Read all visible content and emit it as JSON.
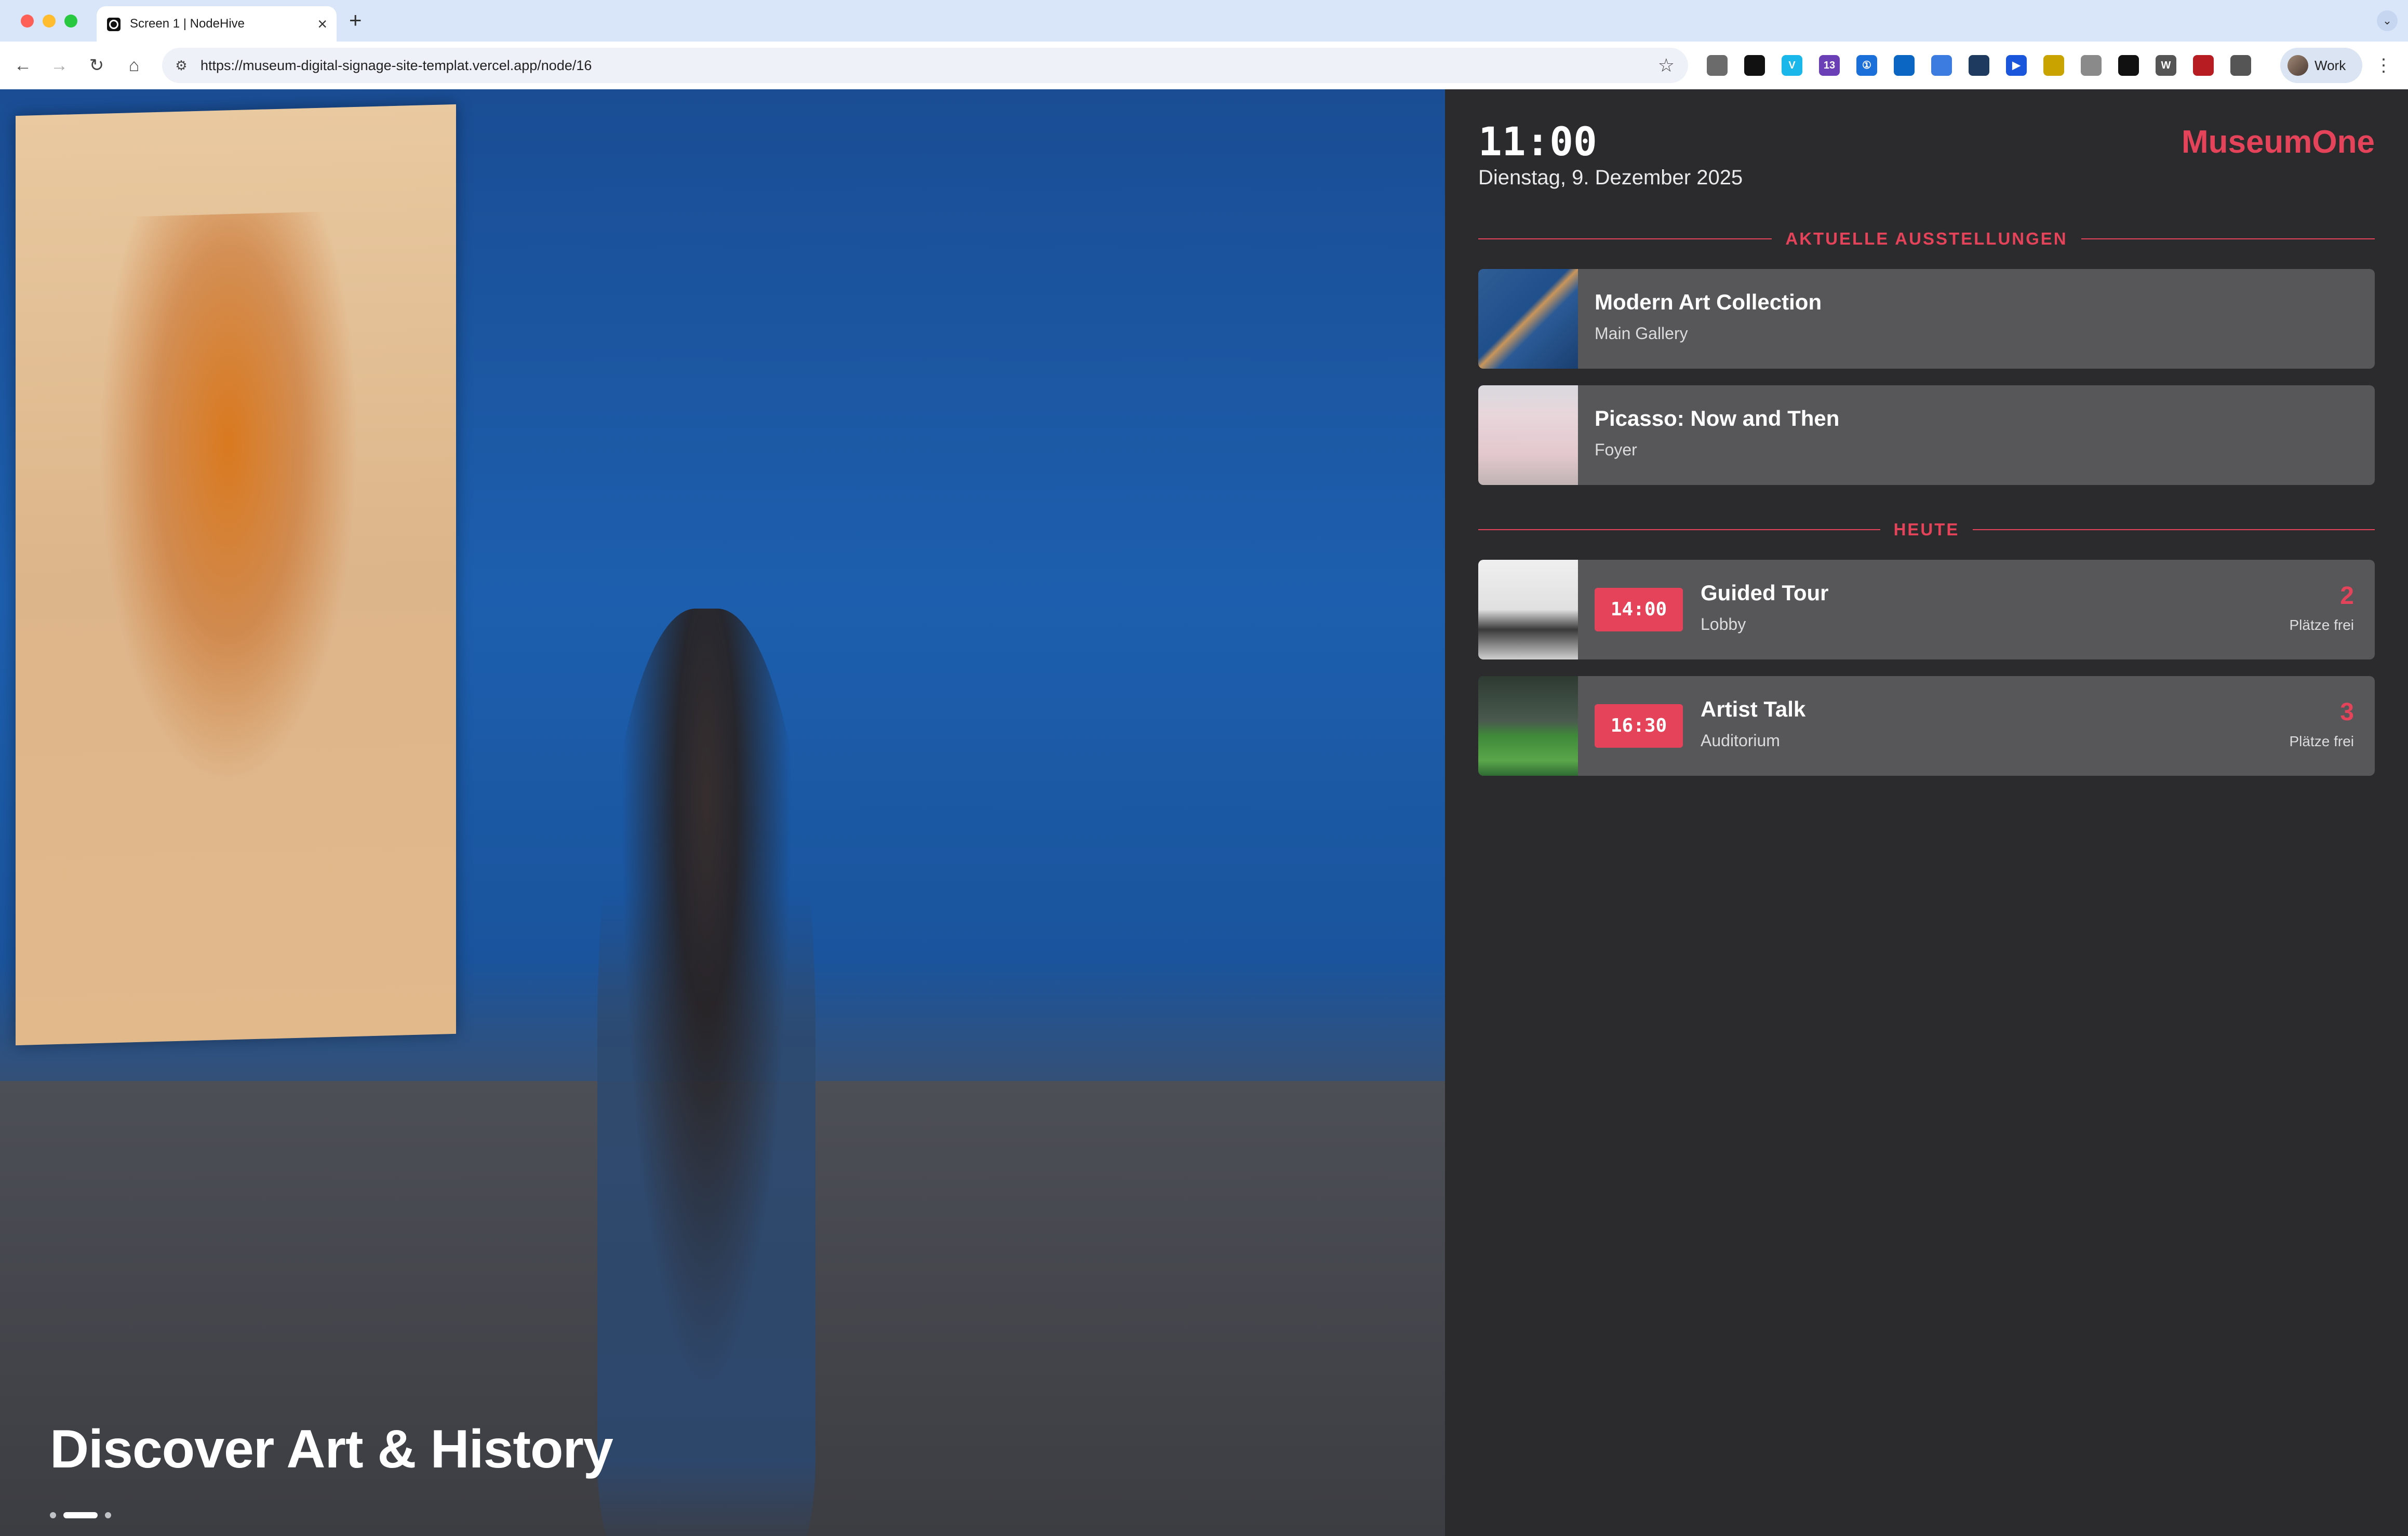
{
  "browser": {
    "tab_title": "Screen 1 | NodeHive",
    "url": "https://museum-digital-signage-site-templat.vercel.app/node/16",
    "profile_name": "Work",
    "extensions": [
      {
        "icon": "ext-generic-icon",
        "color": "#6b6b6b",
        "badge": ""
      },
      {
        "icon": "ext-dark-circle-icon",
        "color": "#111111",
        "badge": ""
      },
      {
        "icon": "vimeo-icon",
        "color": "#1ab7ea",
        "badge": "V"
      },
      {
        "icon": "ext-purple-icon",
        "color": "#6b3fb5",
        "badge": "13"
      },
      {
        "icon": "1password-icon",
        "color": "#1a6fd8",
        "badge": "①"
      },
      {
        "icon": "ext-blue-square-icon",
        "color": "#0a66c2",
        "badge": ""
      },
      {
        "icon": "ext-doc-icon",
        "color": "#3c7be0",
        "badge": ""
      },
      {
        "icon": "ext-react-icon",
        "color": "#1e3a5f",
        "badge": ""
      },
      {
        "icon": "ext-play-icon",
        "color": "#1a56db",
        "badge": "▶"
      },
      {
        "icon": "ext-yellow-icon",
        "color": "#c9a400",
        "badge": ""
      },
      {
        "icon": "camera-icon",
        "color": "#8a8a8a",
        "badge": ""
      },
      {
        "icon": "ext-target-icon",
        "color": "#111111",
        "badge": ""
      },
      {
        "icon": "wordpress-icon",
        "color": "#555555",
        "badge": "W"
      },
      {
        "icon": "ext-red-icon",
        "color": "#b81c23",
        "badge": ""
      },
      {
        "icon": "puzzle-icon",
        "color": "#555555",
        "badge": ""
      }
    ]
  },
  "hero": {
    "title": "Discover Art & History",
    "slide_dots": {
      "count": 3,
      "active": 2
    }
  },
  "sidebar": {
    "time": "11:00",
    "date": "Dienstag, 9. Dezember 2025",
    "brand": "MuseumOne",
    "accent_color": "#e5435a",
    "exhibitions_heading": "AKTUELLE AUSSTELLUNGEN",
    "exhibitions": [
      {
        "title": "Modern Art Collection",
        "location": "Main Gallery"
      },
      {
        "title": "Picasso: Now and Then",
        "location": "Foyer"
      }
    ],
    "today_heading": "HEUTE",
    "events": [
      {
        "time": "14:00",
        "title": "Guided Tour",
        "location": "Lobby",
        "seats": "2",
        "seats_label": "Plätze frei"
      },
      {
        "time": "16:30",
        "title": "Artist Talk",
        "location": "Auditorium",
        "seats": "3",
        "seats_label": "Plätze frei"
      }
    ]
  }
}
